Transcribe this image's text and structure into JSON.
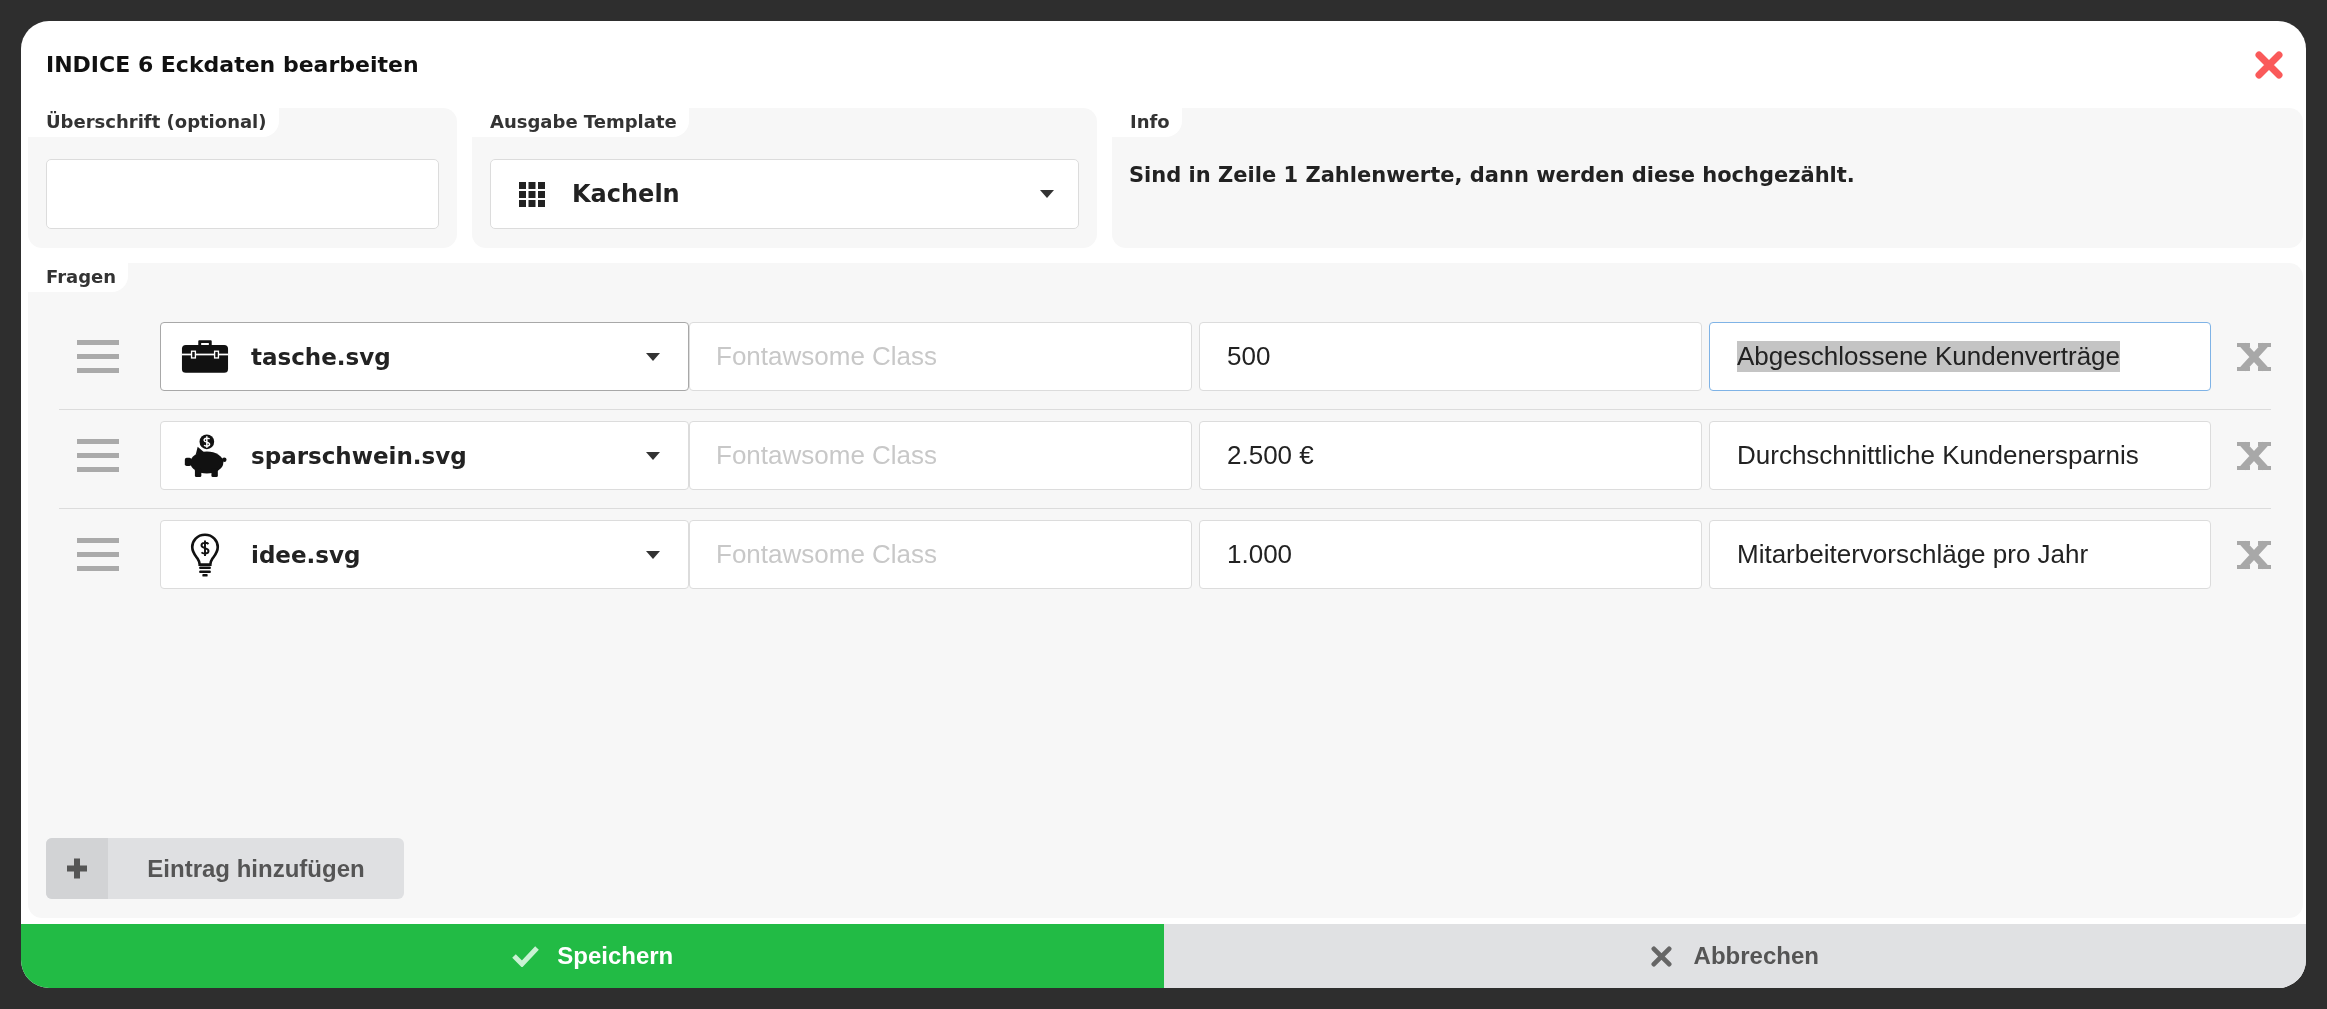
{
  "dialog": {
    "title": "INDICE 6 Eckdaten bearbeiten"
  },
  "heading_panel": {
    "label": "Überschrift (optional)"
  },
  "template_panel": {
    "label": "Ausgabe Template",
    "select": {
      "value": "Kacheln"
    }
  },
  "info_panel": {
    "label": "Info",
    "text": "Sind in Zeile 1 Zahlenwerte, dann werden diese hochgezählt."
  },
  "questions": {
    "label": "Fragen",
    "rows": [
      {
        "icon_select": {
          "value": "tasche.svg",
          "hovered": true
        },
        "class_field": {
          "placeholder": "Fontawsome Class"
        },
        "number_field": {
          "value": "500"
        },
        "label_field": {
          "value": "Abgeschlossene Kundenverträge",
          "focused": true,
          "text_selected": true
        }
      },
      {
        "icon_select": {
          "value": "sparschwein.svg",
          "hovered": false
        },
        "class_field": {
          "placeholder": "Fontawsome Class"
        },
        "number_field": {
          "value": "2.500 €"
        },
        "label_field": {
          "value": "Durchschnittliche Kundenersparnis",
          "focused": false,
          "text_selected": false
        }
      },
      {
        "icon_select": {
          "value": "idee.svg",
          "hovered": false
        },
        "class_field": {
          "placeholder": "Fontawsome Class"
        },
        "number_field": {
          "value": "1.000"
        },
        "label_field": {
          "value": "Mitarbeitervorschläge pro Jahr",
          "focused": false,
          "text_selected": false
        }
      }
    ],
    "add_button": {
      "label": "Eintrag hinzufügen"
    }
  },
  "footer": {
    "buttons": [
      {
        "kind": "save",
        "label": "Speichern"
      },
      {
        "kind": "cancel",
        "label": "Abbrechen"
      }
    ]
  }
}
